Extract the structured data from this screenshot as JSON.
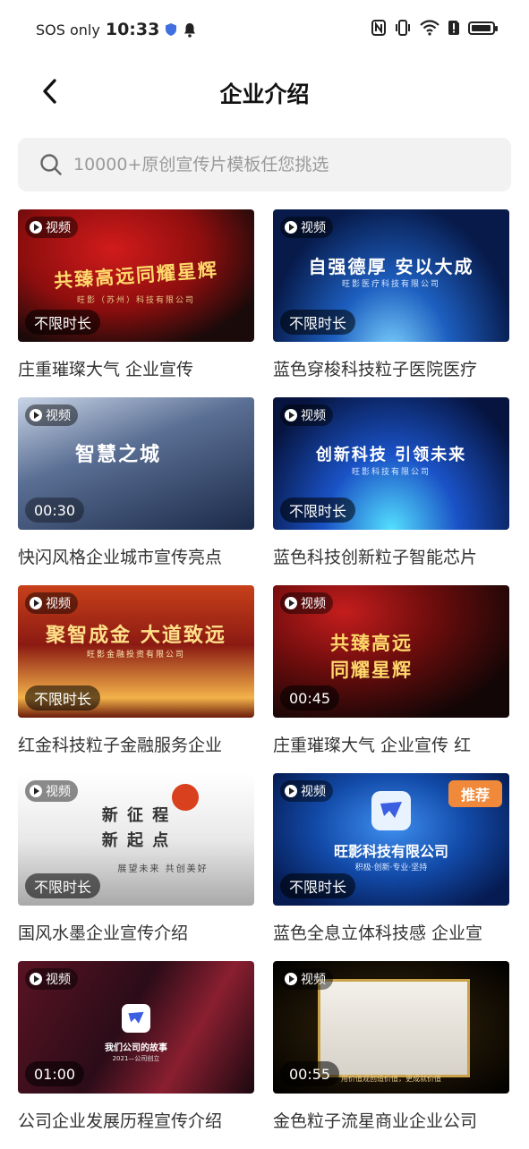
{
  "status": {
    "carrier": "SOS only",
    "time": "10:33"
  },
  "header": {
    "title": "企业介绍"
  },
  "search": {
    "placeholder": "10000+原创宣传片模板任您挑选"
  },
  "labels": {
    "video": "视频",
    "recommended": "推荐"
  },
  "cards": [
    {
      "caption": "庄重璀璨大气 企业宣传",
      "duration": "不限时长",
      "thumb_text": "共臻高远同耀星辉",
      "thumb_sub": "旺影（苏州）科技有限公司",
      "recommended": false
    },
    {
      "caption": "蓝色穿梭科技粒子医院医疗",
      "duration": "不限时长",
      "thumb_text": "自强德厚 安以大成",
      "thumb_sub": "旺影医疗科技有限公司",
      "recommended": false
    },
    {
      "caption": "快闪风格企业城市宣传亮点",
      "duration": "00:30",
      "thumb_text": "智慧之城",
      "thumb_sub": "",
      "recommended": false
    },
    {
      "caption": "蓝色科技创新粒子智能芯片",
      "duration": "不限时长",
      "thumb_text": "创新科技 引领未来",
      "thumb_sub": "旺影科技有限公司",
      "recommended": false
    },
    {
      "caption": "红金科技粒子金融服务企业",
      "duration": "不限时长",
      "thumb_text": "聚智成金 大道致远",
      "thumb_sub": "旺影金融投资有限公司",
      "recommended": false
    },
    {
      "caption": "庄重璀璨大气 企业宣传 红",
      "duration": "00:45",
      "thumb_text": "共臻高远 同耀星辉",
      "thumb_sub": "",
      "recommended": false
    },
    {
      "caption": "国风水墨企业宣传介绍",
      "duration": "不限时长",
      "thumb_text": "新 征 程 新 起 点",
      "thumb_sub": "展望未来 共创美好",
      "recommended": false
    },
    {
      "caption": "蓝色全息立体科技感 企业宣",
      "duration": "不限时长",
      "thumb_text": "旺影科技有限公司",
      "thumb_sub": "积极·创新·专业·坚持",
      "recommended": true
    },
    {
      "caption": "公司企业发展历程宣传介绍",
      "duration": "01:00",
      "thumb_text": "我们公司的故事",
      "thumb_sub": "2021—公司创立",
      "recommended": false
    },
    {
      "caption": "金色粒子流星商业企业公司",
      "duration": "00:55",
      "thumb_text": "",
      "thumb_sub": "用价值观创造价值，更成就价值",
      "recommended": false
    }
  ]
}
